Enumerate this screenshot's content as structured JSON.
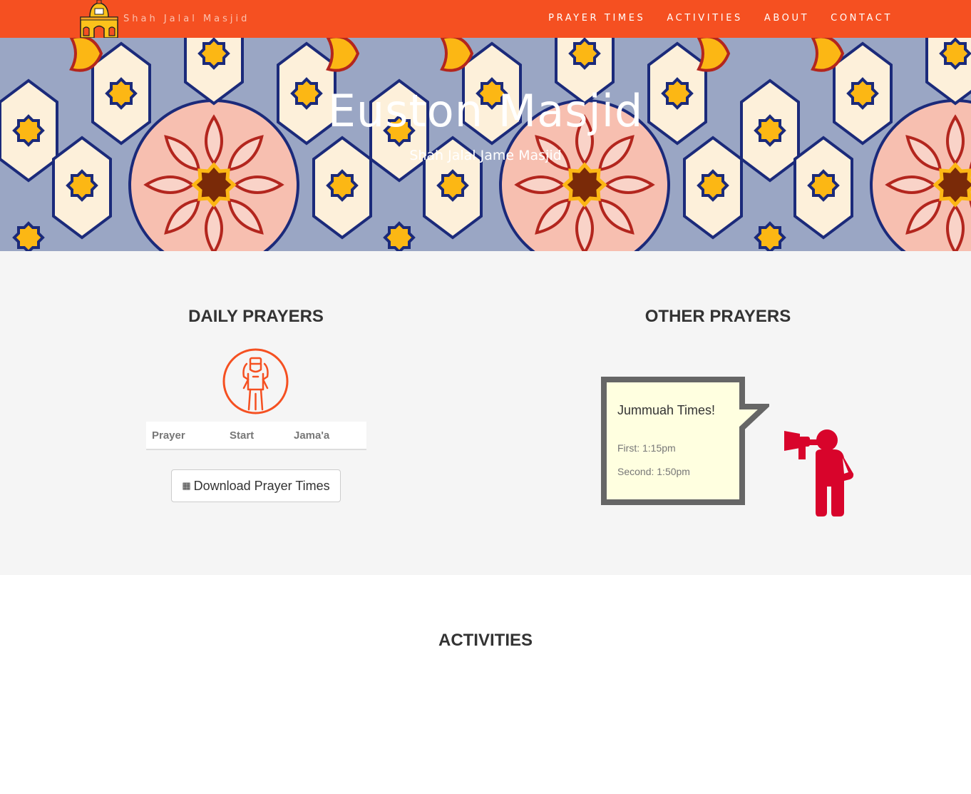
{
  "navbar": {
    "brand_name": "Shah Jalal Masjid",
    "bg_color": "#f55021",
    "links": [
      {
        "label": "PRAYER TIMES"
      },
      {
        "label": "ACTIVITIES"
      },
      {
        "label": "ABOUT"
      },
      {
        "label": "CONTACT"
      }
    ]
  },
  "hero": {
    "title": "Euston Masjid",
    "subtitle": "Shah Jalal Jame Masjid"
  },
  "daily_prayers": {
    "heading": "DAILY PRAYERS",
    "icon": "praying-man-icon",
    "table": {
      "columns": [
        "Prayer",
        "Start",
        "Jama'a"
      ],
      "rows": []
    },
    "download_button": {
      "icon": "file-icon",
      "label": "Download Prayer Times"
    }
  },
  "other_prayers": {
    "heading": "OTHER PRAYERS",
    "sign_title": "Jummuah Times!",
    "first": "First: 1:15pm",
    "second": "Second: 1:50pm",
    "icon": "megaphone-announcer-icon"
  },
  "activities": {
    "heading": "ACTIVITIES"
  },
  "colors": {
    "accent": "#f55021",
    "section_bg": "#f5f5f5",
    "announcer_red": "#d8042b",
    "sign_yellow": "#ffffe0"
  }
}
